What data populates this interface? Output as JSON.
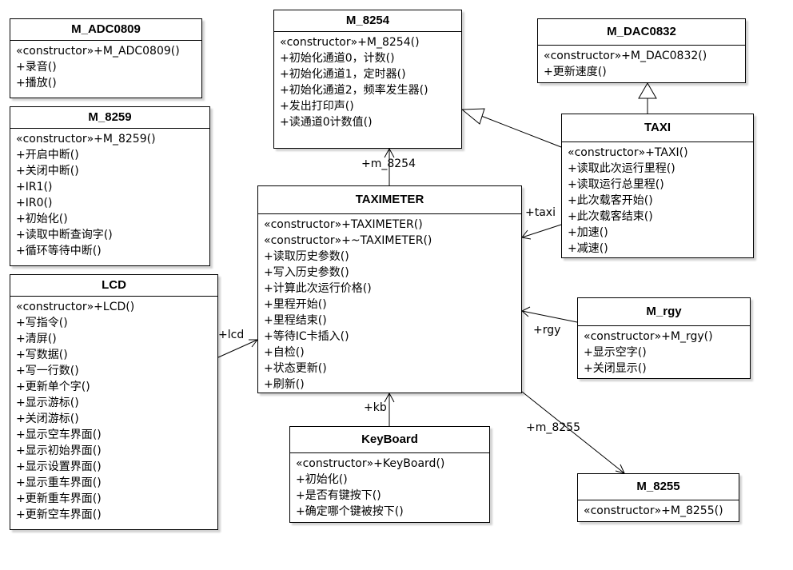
{
  "classes": {
    "adc0809": {
      "name": "M_ADC0809",
      "ops": [
        "«constructor»+M_ADC0809()",
        "+录音()",
        "+播放()"
      ]
    },
    "m8259": {
      "name": "M_8259",
      "ops": [
        "«constructor»+M_8259()",
        "+开启中断()",
        "+关闭中断()",
        "+IR1()",
        "+IR0()",
        "+初始化()",
        "+读取中断查询字()",
        "+循环等待中断()"
      ]
    },
    "lcd": {
      "name": "LCD",
      "ops": [
        "«constructor»+LCD()",
        "+写指令()",
        "+清屏()",
        "+写数据()",
        "+写一行数()",
        "+更新单个字()",
        "+显示游标()",
        "+关闭游标()",
        "+显示空车界面()",
        "+显示初始界面()",
        "+显示设置界面()",
        "+显示重车界面()",
        "+更新重车界面()",
        "+更新空车界面()"
      ]
    },
    "m8254": {
      "name": "M_8254",
      "ops": [
        "«constructor»+M_8254()",
        "+初始化通道0，计数()",
        "+初始化通道1，定时器()",
        "+初始化通道2，频率发生器()",
        "+发出打印声()",
        "+读通道0计数值()"
      ]
    },
    "taximeter": {
      "name": "TAXIMETER",
      "ops": [
        "«constructor»+TAXIMETER()",
        "«constructor»+~TAXIMETER()",
        "+读取历史参数()",
        "+写入历史参数()",
        "+计算此次运行价格()",
        "+里程开始()",
        "+里程结束()",
        "+等待IC卡插入()",
        "+自检()",
        "+状态更新()",
        "+刷新()"
      ]
    },
    "keyboard": {
      "name": "KeyBoard",
      "ops": [
        "«constructor»+KeyBoard()",
        "+初始化()",
        "+是否有键按下()",
        "+确定哪个键被按下()"
      ]
    },
    "dac0832": {
      "name": "M_DAC0832",
      "ops": [
        "«constructor»+M_DAC0832()",
        "+更新速度()"
      ]
    },
    "taxi": {
      "name": "TAXI",
      "ops": [
        "«constructor»+TAXI()",
        "+读取此次运行里程()",
        "+读取运行总里程()",
        "+此次载客开始()",
        "+此次载客结束()",
        "+加速()",
        "+减速()"
      ]
    },
    "rgy": {
      "name": "M_rgy",
      "ops": [
        "«constructor»+M_rgy()",
        "+显示空字()",
        "+关闭显示()"
      ]
    },
    "m8255": {
      "name": "M_8255",
      "ops": [
        "«constructor»+M_8255()"
      ]
    }
  },
  "associations": {
    "m_8254": "+m_8254",
    "taxi": "+taxi",
    "lcd": "+lcd",
    "rgy": "+rgy",
    "kb": "+kb",
    "m_8255": "+m_8255"
  }
}
